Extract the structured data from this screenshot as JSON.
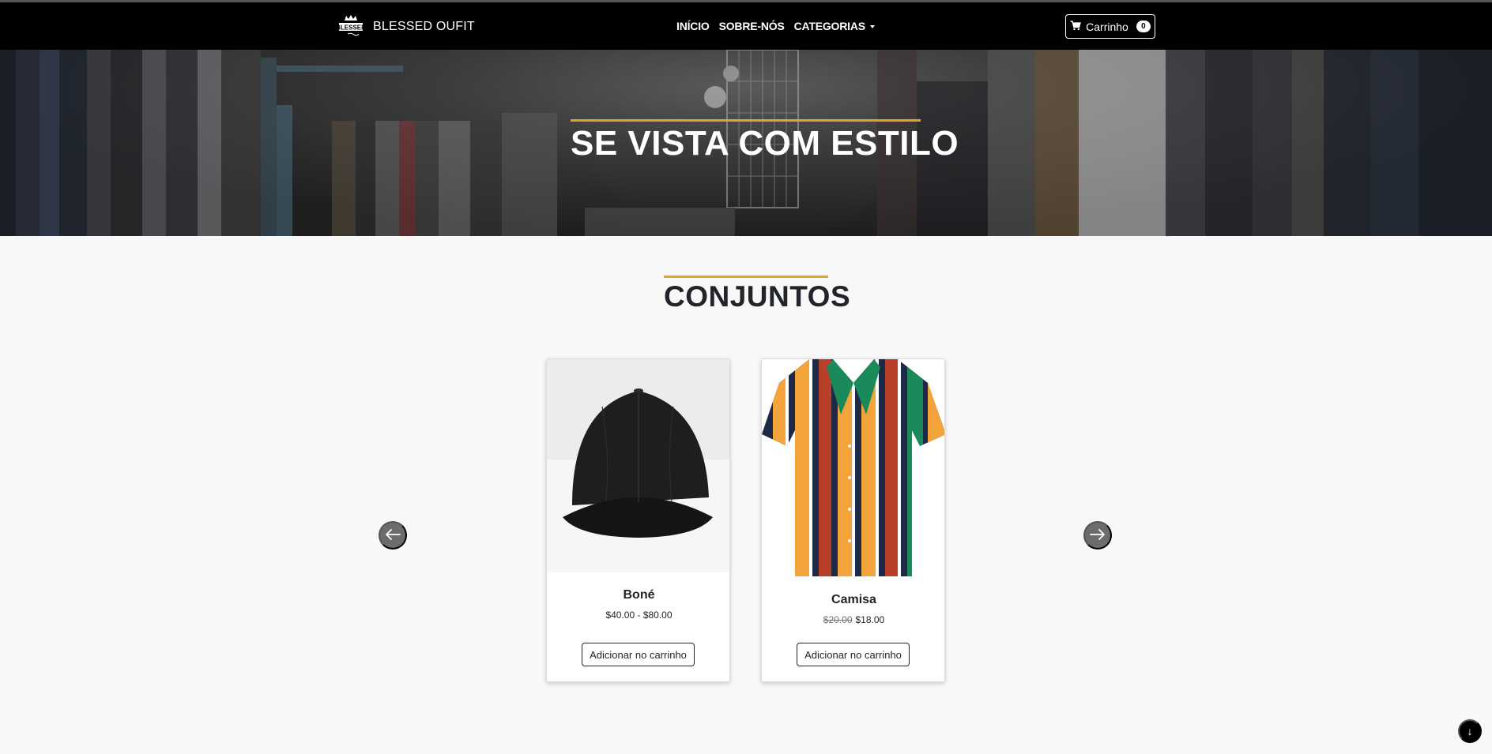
{
  "navbar": {
    "brand": "BLESSED OUFIT",
    "logo_text": "BLESSED",
    "links": [
      {
        "label": "INÍCIO"
      },
      {
        "label": "SOBRE-NÓS"
      },
      {
        "label": "CATEGORIAS"
      }
    ],
    "cart_label": "Carrinho",
    "cart_count": "0"
  },
  "hero": {
    "title": "SE VISTA COM ESTILO"
  },
  "section": {
    "title": "CONJUNTOS"
  },
  "products": [
    {
      "name": "Boné",
      "price": "$40.00 - $80.00",
      "button": "Adicionar no carrinho"
    },
    {
      "name": "Camisa",
      "old_price": "$20.00",
      "price": "$18.00",
      "button": "Adicionar no carrinho"
    }
  ],
  "scroll_button": "↓",
  "colors": {
    "accent": "#e0a526",
    "navbar": "#000000",
    "background": "#f8f8f8"
  },
  "icons": [
    "crown-logo-icon",
    "cart-icon",
    "caret-down-icon",
    "arrow-left-icon",
    "arrow-right-icon",
    "arrow-down-icon"
  ]
}
